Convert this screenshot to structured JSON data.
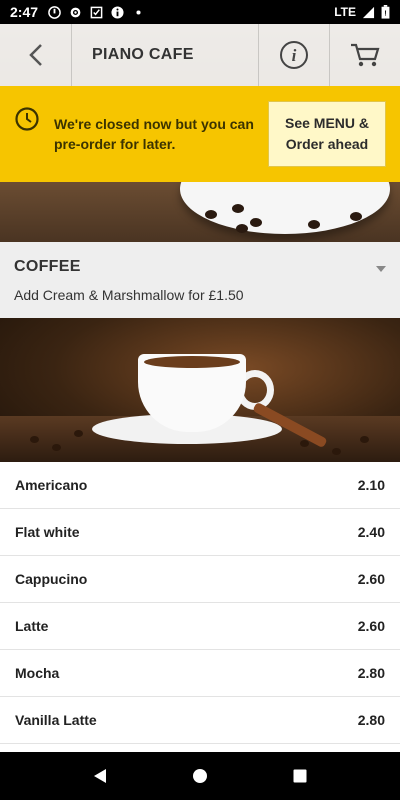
{
  "status_bar": {
    "time": "2:47",
    "network": "LTE",
    "icons_left": [
      "notification-icon",
      "settings-icon",
      "checklist-icon",
      "info-icon",
      "dot-icon"
    ],
    "icons_right": [
      "signal-icon",
      "battery-icon"
    ]
  },
  "toolbar": {
    "title": "PIANO CAFE",
    "icons": [
      "back-icon",
      "info-icon",
      "cart-icon"
    ]
  },
  "banner": {
    "message": "We're closed now but you can pre-order for later.",
    "button_label": "See MENU & Order ahead",
    "color": "#f6c500"
  },
  "section": {
    "title": "COFFEE",
    "subtitle": "Add Cream & Marshmallow for £1.50"
  },
  "menu": {
    "items": [
      {
        "name": "Americano",
        "price": "2.10"
      },
      {
        "name": "Flat white",
        "price": "2.40"
      },
      {
        "name": "Cappucino",
        "price": "2.60"
      },
      {
        "name": "Latte",
        "price": "2.60"
      },
      {
        "name": "Mocha",
        "price": "2.80"
      },
      {
        "name": "Vanilla Latte",
        "price": "2.80"
      }
    ]
  },
  "nav": {
    "icons": [
      "back-triangle-icon",
      "home-circle-icon",
      "recents-square-icon"
    ]
  }
}
